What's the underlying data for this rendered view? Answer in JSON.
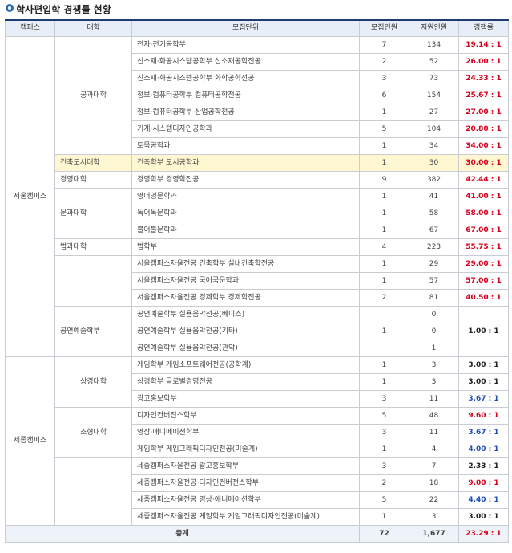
{
  "page_title": "학사편입학 경쟁률 현황",
  "headers": [
    "캠퍼스",
    "대학",
    "모집단위",
    "모집인원",
    "지원인원",
    "경쟁률"
  ],
  "seoul": {
    "campus": "서울캠퍼스",
    "colleges": [
      {
        "name": "공과대학",
        "rows": [
          {
            "unit": "전자·전기공학부",
            "quota": "7",
            "applicants": "134",
            "ratio": "19.14 : 1"
          },
          {
            "unit": "신소재·화공시스템공학부 신소재공학전공",
            "quota": "2",
            "applicants": "52",
            "ratio": "26.00 : 1"
          },
          {
            "unit": "신소재·화공시스템공학부 화학공학전공",
            "quota": "3",
            "applicants": "73",
            "ratio": "24.33 : 1"
          },
          {
            "unit": "정보·컴퓨터공학부 컴퓨터공학전공",
            "quota": "6",
            "applicants": "154",
            "ratio": "25.67 : 1"
          },
          {
            "unit": "정보·컴퓨터공학부 산업공학전공",
            "quota": "1",
            "applicants": "27",
            "ratio": "27.00 : 1"
          },
          {
            "unit": "기계·시스템디자인공학과",
            "quota": "5",
            "applicants": "104",
            "ratio": "20.80 : 1"
          },
          {
            "unit": "토목공학과",
            "quota": "1",
            "applicants": "34",
            "ratio": "34.00 : 1"
          }
        ]
      },
      {
        "name": "건축도시대학",
        "rows": [
          {
            "unit": "건축학부 도시공학과",
            "quota": "1",
            "applicants": "30",
            "ratio": "30.00 : 1"
          }
        ]
      },
      {
        "name": "경영대학",
        "rows": [
          {
            "unit": "경영학부 경영학전공",
            "quota": "9",
            "applicants": "382",
            "ratio": "42.44 : 1"
          }
        ]
      },
      {
        "name": "문과대학",
        "rows": [
          {
            "unit": "영어영문학과",
            "quota": "1",
            "applicants": "41",
            "ratio": "41.00 : 1"
          },
          {
            "unit": "독어독문학과",
            "quota": "1",
            "applicants": "58",
            "ratio": "58.00 : 1"
          },
          {
            "unit": "불어불문학과",
            "quota": "1",
            "applicants": "67",
            "ratio": "67.00 : 1"
          }
        ]
      },
      {
        "name": "법과대학",
        "rows": [
          {
            "unit": "법학부",
            "quota": "4",
            "applicants": "223",
            "ratio": "55.75 : 1"
          }
        ]
      },
      {
        "name": "",
        "rows": [
          {
            "unit": "서울캠퍼스자율전공 건축학부 실내건축학전공",
            "quota": "1",
            "applicants": "29",
            "ratio": "29.00 : 1"
          },
          {
            "unit": "서울캠퍼스자율전공 국어국문학과",
            "quota": "1",
            "applicants": "57",
            "ratio": "57.00 : 1"
          },
          {
            "unit": "서울캠퍼스자율전공 경제학부 경제학전공",
            "quota": "2",
            "applicants": "81",
            "ratio": "40.50 : 1"
          }
        ]
      },
      {
        "name": "공연예술학부",
        "quota": "1",
        "ratio": "1.00 : 1",
        "rows": [
          {
            "unit": "공연예술학부 실용음악전공(베이스)",
            "applicants": "0"
          },
          {
            "unit": "공연예술학부 실용음악전공(기타)",
            "applicants": "0"
          },
          {
            "unit": "공연예술학부 실용음악전공(관악)",
            "applicants": "1"
          }
        ]
      }
    ]
  },
  "sejong": {
    "campus": "세종캠퍼스",
    "rows": [
      {
        "college": "",
        "unit": "게임학부 게임소프트웨어전공(공학계)",
        "quota": "1",
        "applicants": "3",
        "ratio": "3.00 : 1"
      },
      {
        "college": "상경대학",
        "unit": "상경학부 글로벌경영전공",
        "quota": "1",
        "applicants": "3",
        "ratio": "3.00 : 1"
      },
      {
        "college": "",
        "unit": "광고홍보학부",
        "quota": "3",
        "applicants": "11",
        "ratio": "3.67 : 1"
      },
      {
        "college": "조형대학",
        "unit": "디자인컨버전스학부",
        "quota": "5",
        "applicants": "48",
        "ratio": "9.60 : 1"
      },
      {
        "college": "",
        "unit": "영상·애니메이션학부",
        "quota": "3",
        "applicants": "11",
        "ratio": "3.67 : 1"
      },
      {
        "college": "",
        "unit": "게임학부 게임그래픽디자인전공(미술계)",
        "quota": "1",
        "applicants": "4",
        "ratio": "4.00 : 1"
      },
      {
        "college": "",
        "unit": "세종캠퍼스자율전공 광고홍보학부",
        "quota": "3",
        "applicants": "7",
        "ratio": "2.33 : 1"
      },
      {
        "college": "",
        "unit": "세종캠퍼스자율전공 디자인컨버전스학부",
        "quota": "2",
        "applicants": "18",
        "ratio": "9.00 : 1"
      },
      {
        "college": "",
        "unit": "세종캠퍼스자율전공 영상·애니메이션학부",
        "quota": "5",
        "applicants": "22",
        "ratio": "4.40 : 1"
      },
      {
        "college": "",
        "unit": "세종캠퍼스자율전공 게임학부 게임그래픽디자인전공(미술계)",
        "quota": "1",
        "applicants": "3",
        "ratio": "3.00 : 1"
      }
    ]
  },
  "total": {
    "label": "총계",
    "quota": "72",
    "applicants": "1,677",
    "ratio": "23.29 : 1"
  },
  "colors": {
    "accent": "#1e3c72",
    "highlight": "#fff6d2",
    "red": "#d9001b",
    "blue": "#1f4fb8"
  }
}
